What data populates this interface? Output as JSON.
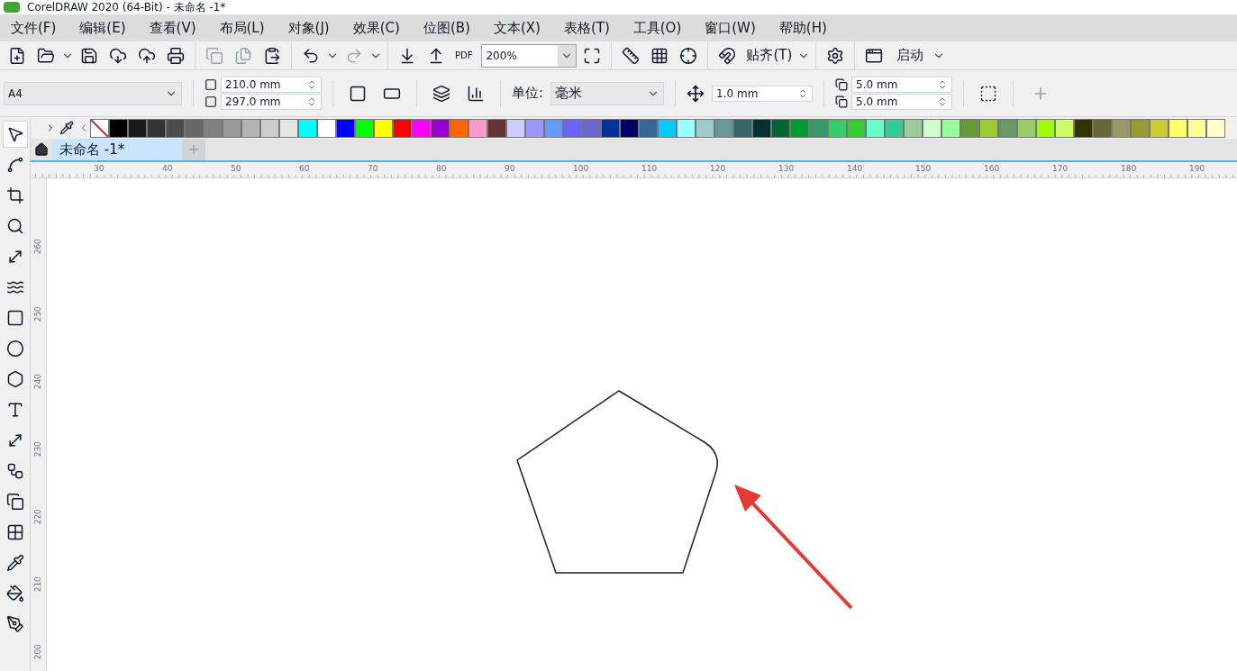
{
  "window": {
    "title": "CorelDRAW 2020 (64-Bit) - 未命名 -1*"
  },
  "menu": [
    "文件(F)",
    "编辑(E)",
    "查看(V)",
    "布局(L)",
    "对象(J)",
    "效果(C)",
    "位图(B)",
    "文本(X)",
    "表格(T)",
    "工具(O)",
    "窗口(W)",
    "帮助(H)"
  ],
  "toolbar": {
    "pdf_label": "PDF",
    "zoom_value": "200%",
    "snap_label": "贴齐(T)",
    "launch_label": "启动"
  },
  "property_bar": {
    "page_size": "A4",
    "width": "210.0 mm",
    "height": "297.0 mm",
    "units_label": "单位:",
    "units": "毫米",
    "nudge": "1.0 mm",
    "dup_x": "5.0 mm",
    "dup_y": "5.0 mm"
  },
  "tools": [
    {
      "kind": "pick",
      "selected": true
    },
    {
      "kind": "shape",
      "selected": false
    },
    {
      "kind": "crop",
      "selected": false
    },
    {
      "kind": "zoom",
      "selected": false
    },
    {
      "kind": "line",
      "selected": false
    },
    {
      "kind": "curve",
      "selected": false
    },
    {
      "kind": "rectangle",
      "selected": false
    },
    {
      "kind": "ellipse",
      "selected": false
    },
    {
      "kind": "polygon",
      "selected": false
    },
    {
      "kind": "text",
      "selected": false
    },
    {
      "kind": "dimension",
      "selected": false
    },
    {
      "kind": "connector",
      "selected": false
    },
    {
      "kind": "shadow",
      "selected": false
    },
    {
      "kind": "transparency",
      "selected": false
    },
    {
      "kind": "eyedropper",
      "selected": false
    },
    {
      "kind": "fill",
      "selected": false
    },
    {
      "kind": "pen",
      "selected": false
    }
  ],
  "palette": [
    {
      "color": "#000000"
    },
    {
      "color": "#1a1a1a"
    },
    {
      "color": "#333333"
    },
    {
      "color": "#4d4d4d"
    },
    {
      "color": "#666666"
    },
    {
      "color": "#808080"
    },
    {
      "color": "#999999"
    },
    {
      "color": "#b3b3b3"
    },
    {
      "color": "#cccccc"
    },
    {
      "color": "#e5e5e5"
    },
    {
      "color": "#00ffff"
    },
    {
      "color": "#ffffff"
    },
    {
      "color": "#0000ff"
    },
    {
      "color": "#00ff00"
    },
    {
      "color": "#ffff00"
    },
    {
      "color": "#ff0000"
    },
    {
      "color": "#ff00ff"
    },
    {
      "color": "#9900cc"
    },
    {
      "color": "#ff6600"
    },
    {
      "color": "#ff99cc"
    },
    {
      "color": "#663333"
    },
    {
      "color": "#ccccff"
    },
    {
      "color": "#9999ff"
    },
    {
      "color": "#6699ff"
    },
    {
      "color": "#6666ff"
    },
    {
      "color": "#6666cc"
    },
    {
      "color": "#003399"
    },
    {
      "color": "#000066"
    },
    {
      "color": "#336699"
    },
    {
      "color": "#00ccff"
    },
    {
      "color": "#99ffff"
    },
    {
      "color": "#99cccc"
    },
    {
      "color": "#669999"
    },
    {
      "color": "#336666"
    },
    {
      "color": "#003333"
    },
    {
      "color": "#006633"
    },
    {
      "color": "#009933"
    },
    {
      "color": "#339966"
    },
    {
      "color": "#33cc66"
    },
    {
      "color": "#33cc33"
    },
    {
      "color": "#66ffcc"
    },
    {
      "color": "#33cc99"
    },
    {
      "color": "#99cc99"
    },
    {
      "color": "#ccffcc"
    },
    {
      "color": "#99ff99"
    },
    {
      "color": "#669933"
    },
    {
      "color": "#99cc33"
    },
    {
      "color": "#669966"
    },
    {
      "color": "#99cc66"
    },
    {
      "color": "#99ff00"
    },
    {
      "color": "#ccff66"
    },
    {
      "color": "#333300"
    },
    {
      "color": "#666633"
    },
    {
      "color": "#999966"
    },
    {
      "color": "#999933"
    },
    {
      "color": "#cccc33"
    },
    {
      "color": "#ffff66"
    },
    {
      "color": "#ffff99"
    },
    {
      "color": "#ffffcc"
    }
  ],
  "tabs": [
    {
      "label": "未命名 -1*",
      "selected": true
    }
  ],
  "horizontal_ruler": [
    "30",
    "40",
    "50",
    "60",
    "70",
    "80",
    "90",
    "100",
    "110",
    "120",
    "130",
    "140",
    "150",
    "160",
    "170",
    "180",
    "190"
  ],
  "vertical_ruler": [
    "260",
    "250",
    "240",
    "230",
    "220",
    "210",
    "200"
  ]
}
